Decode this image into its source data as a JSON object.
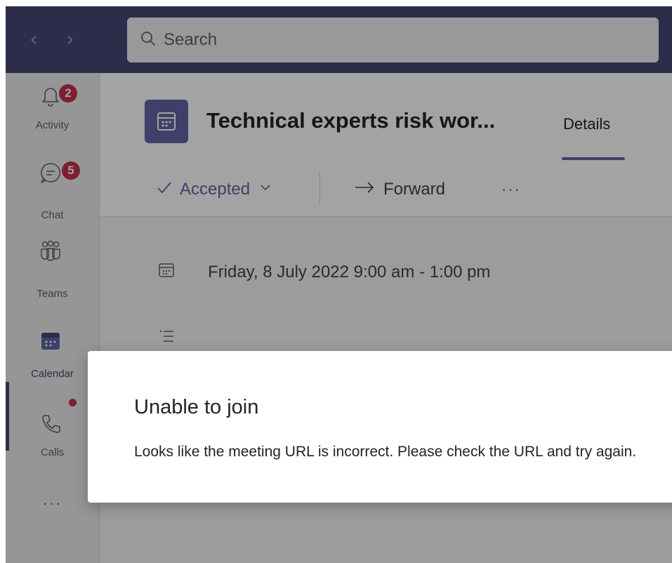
{
  "titlebar": {
    "back_icon": "chevron-left-icon",
    "forward_icon": "chevron-right-icon",
    "search_placeholder": "Search"
  },
  "rail": {
    "items": [
      {
        "label": "Activity",
        "icon": "bell-icon",
        "badge": "2"
      },
      {
        "label": "Chat",
        "icon": "chat-icon",
        "badge": "5"
      },
      {
        "label": "Teams",
        "icon": "teams-icon"
      },
      {
        "label": "Calendar",
        "icon": "calendar-icon",
        "active": true
      },
      {
        "label": "Calls",
        "icon": "phone-icon",
        "dot": true
      }
    ],
    "more": "···"
  },
  "meeting": {
    "title": "Technical experts risk wor...",
    "tab": "Details",
    "toolbar": {
      "accepted": "Accepted",
      "forward": "Forward",
      "more": "···"
    },
    "datetime": "Friday, 8 July 2022 9:00 am - 1:00 pm"
  },
  "dialog": {
    "title": "Unable to join",
    "message": "Looks like the meeting URL is incorrect. Please check the URL and try again."
  },
  "colors": {
    "titlebar": "#464775",
    "accent": "#6264a7",
    "badge": "#c4314b"
  }
}
